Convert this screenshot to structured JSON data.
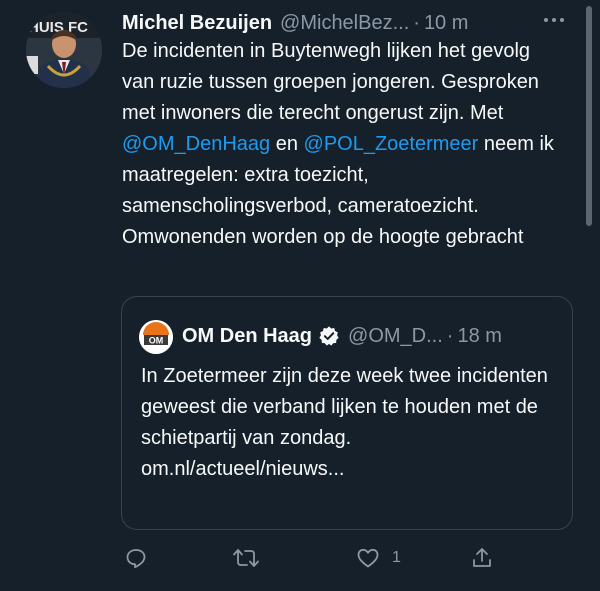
{
  "tweet": {
    "author_name": "Michel Bezuijen",
    "handle": "@MichelBez...",
    "separator": "·",
    "time": "10 m",
    "avatar_text": "HUIS FC",
    "text_part1": "De incidenten in Buytenwegh lijken het gevolg van ruzie tussen groepen jongeren. Gesproken met inwoners die terecht ongerust zijn. Met ",
    "mention1": "@OM_DenHaag",
    "text_part2": " en ",
    "mention2": "@POL_Zoetermeer",
    "text_part3": " neem ik maatregelen: extra toezicht, samenscholingsverbod, cameratoezicht. Omwonenden worden op de hoogte gebracht",
    "more_icon": "more-horizontal-icon"
  },
  "quote": {
    "logo_text": "OM",
    "author_name": "OM Den Haag",
    "verified_icon": "verified-badge-icon",
    "handle": "@OM_D...",
    "separator": "·",
    "time": "18 m",
    "text": "In Zoetermeer zijn deze week twee incidenten geweest die verband lijken te houden met de schietpartij van zondag.",
    "link": "om.nl/actueel/nieuws..."
  },
  "actions": {
    "reply_icon": "reply-icon",
    "retweet_icon": "retweet-icon",
    "like_icon": "heart-icon",
    "like_count": "1",
    "share_icon": "share-icon"
  },
  "colors": {
    "background": "#15202b",
    "text": "#f7f9f9",
    "secondary": "#8b98a5",
    "accent": "#1d9bf0",
    "border": "#38444d"
  }
}
